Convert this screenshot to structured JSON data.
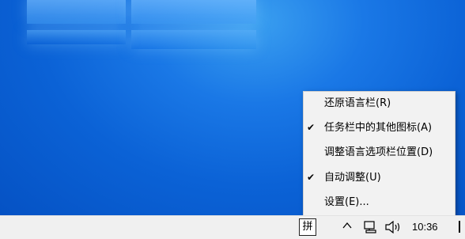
{
  "menu": {
    "items": [
      {
        "label": "还原语言栏(R)",
        "checked": false
      },
      {
        "label": "任务栏中的其他图标(A)",
        "checked": true
      },
      {
        "label": "调整语言选项栏位置(D)",
        "checked": false
      },
      {
        "label": "自动调整(U)",
        "checked": true
      },
      {
        "label": "设置(E)...",
        "checked": false
      }
    ],
    "check_glyph": "✔"
  },
  "taskbar": {
    "ime_label": "拼",
    "chevron": "^",
    "network_icon": "network-icon",
    "volume_icon": "speaker-icon",
    "clock": "10:36"
  },
  "colors": {
    "desktop": "#0a64d6",
    "taskbar": "#f0f0f0",
    "menu_bg": "#f2f2f2"
  }
}
